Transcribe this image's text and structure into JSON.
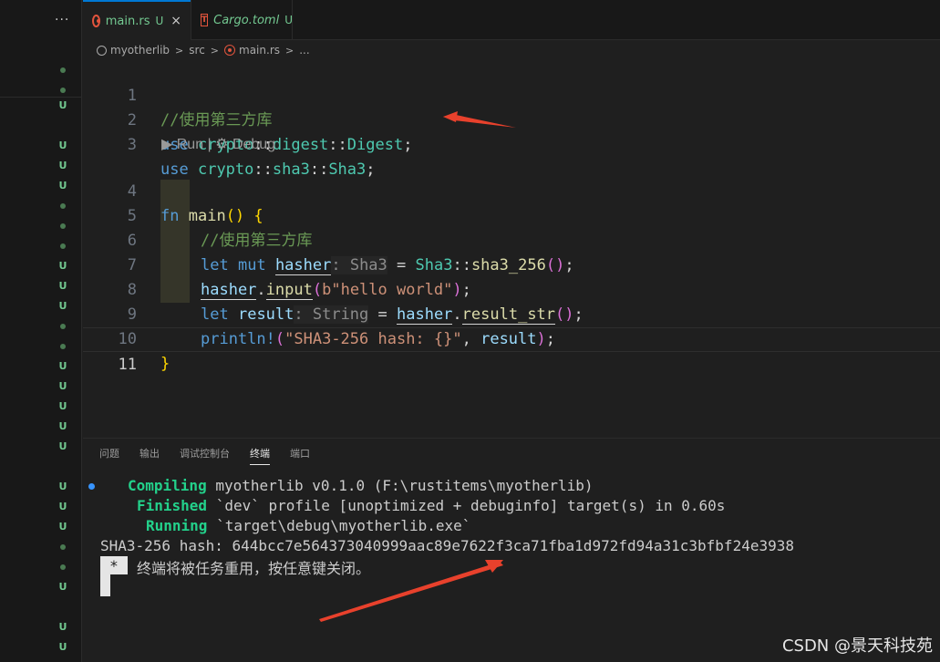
{
  "sidebar": {
    "more_label": "···",
    "marks": [
      "•",
      "•",
      "U",
      "U",
      "U",
      "U",
      "•",
      "•",
      "•",
      "U",
      "U",
      "U",
      "•",
      "•",
      "U",
      "U",
      "U",
      "U",
      "U",
      "U",
      "U",
      "U",
      "•",
      "•",
      "U",
      "U",
      "U"
    ]
  },
  "tabs": [
    {
      "label": "main.rs",
      "status": "U",
      "close": "×",
      "icon": "rust-icon"
    },
    {
      "label": "Cargo.toml",
      "status": "U",
      "icon": "toml-icon",
      "icon_text": "T"
    }
  ],
  "breadcrumb": {
    "project": "myotherlib",
    "folder": "src",
    "file": "main.rs",
    "more": "..."
  },
  "editor": {
    "line_numbers": [
      "1",
      "2",
      "3",
      "4",
      "5",
      "6",
      "7",
      "8",
      "9",
      "10",
      "11"
    ],
    "comment1": "//使用第三方库",
    "use": "use",
    "crypto": "crypto",
    "sep": "::",
    "digest_mod": "digest",
    "digest_type": "Digest",
    "semi": ";",
    "sha3_mod": "sha3",
    "sha3_type": "Sha3",
    "lens_run": "▶ Run",
    "lens_sep": " | ",
    "lens_debug": "⚙ Debug",
    "fn": "fn",
    "main": "main",
    "parens": "()",
    "brace_open": " {",
    "comment2": "//使用第三方库",
    "let": "let",
    "mut": "mut",
    "hasher": "hasher",
    "hint_sha3": ": Sha3",
    "eq": " = ",
    "sha3_256": "sha3_256",
    "input": "input",
    "input_arg": "b\"hello world\"",
    "result": "result",
    "hint_string": ": String",
    "result_str": "result_str",
    "println": "println!",
    "fmt_str": "\"SHA3-256 hash: {}\"",
    "comma": ", ",
    "brace_close": "}"
  },
  "panel": {
    "tabs": [
      "问题",
      "输出",
      "调试控制台",
      "终端",
      "端口"
    ],
    "active_tab": "终端",
    "compiling_label": "Compiling",
    "compiling_text": " myotherlib v0.1.0 (F:\\rustitems\\myotherlib)",
    "finished_label": "Finished",
    "finished_text": " `dev` profile [unoptimized + debuginfo] target(s) in 0.60s",
    "running_label": "Running",
    "running_text": " `target\\debug\\myotherlib.exe`",
    "hash_line": "SHA3-256 hash: 644bcc7e564373040999aac89e7622f3ca71fba1d972fd94a31c3bfbf24e3938",
    "cursor_char": "*",
    "exit_msg": "终端将被任务重用，按任意键关闭。"
  },
  "watermark": "CSDN @景天科技苑",
  "colors": {
    "accent": "#0078d4",
    "untracked": "#73c991",
    "terminal_green": "#23d18b",
    "arrow": "#e8412c"
  }
}
